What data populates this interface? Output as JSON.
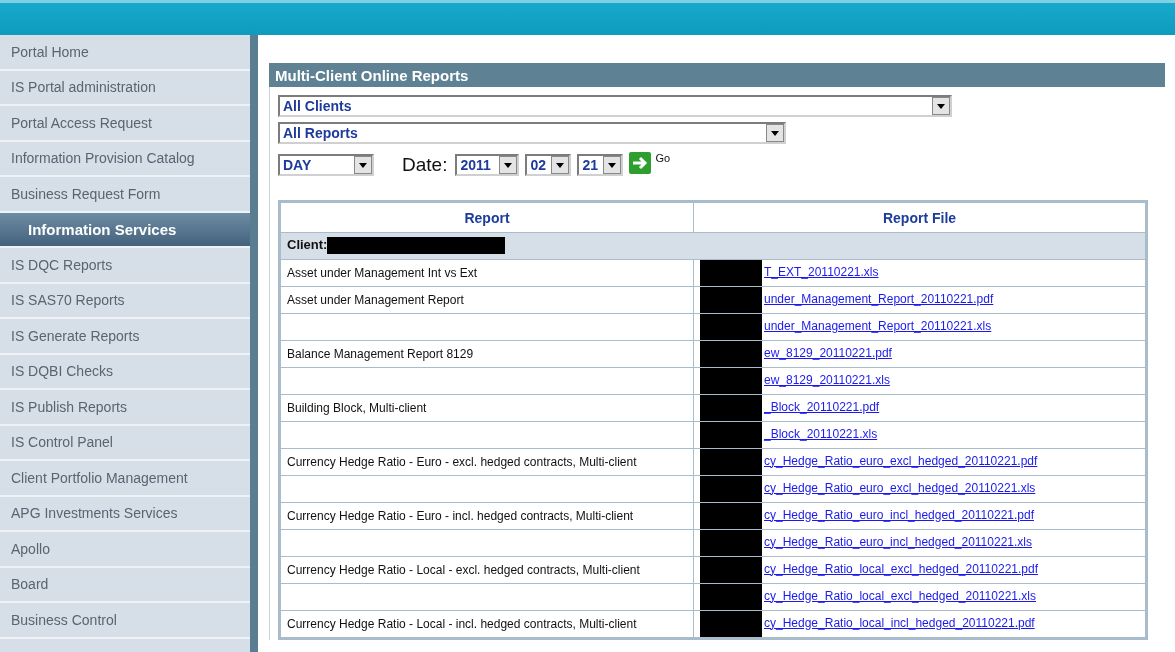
{
  "sidebar": {
    "items": [
      {
        "label": "Portal Home",
        "kind": "link"
      },
      {
        "label": "IS Portal administration",
        "kind": "link"
      },
      {
        "label": "Portal Access Request",
        "kind": "link"
      },
      {
        "label": "Information Provision Catalog",
        "kind": "link"
      },
      {
        "label": "Business Request Form",
        "kind": "link"
      },
      {
        "label": "Information Services",
        "kind": "section"
      },
      {
        "label": "IS DQC Reports",
        "kind": "link"
      },
      {
        "label": "IS SAS70 Reports",
        "kind": "link"
      },
      {
        "label": "IS Generate Reports",
        "kind": "link"
      },
      {
        "label": "IS DQBI Checks",
        "kind": "link"
      },
      {
        "label": "IS Publish Reports",
        "kind": "link"
      },
      {
        "label": "IS Control Panel",
        "kind": "link"
      },
      {
        "label": "Client Portfolio Management",
        "kind": "link"
      },
      {
        "label": "APG Investments Services",
        "kind": "link"
      },
      {
        "label": "Apollo",
        "kind": "link"
      },
      {
        "label": "Board",
        "kind": "link"
      },
      {
        "label": "Business Control",
        "kind": "link"
      }
    ]
  },
  "panel": {
    "title": "Multi-Client Online Reports",
    "client_select": "All Clients",
    "report_select": "All Reports",
    "period_select": "DAY",
    "date_label": "Date:",
    "year": "2011",
    "month": "02",
    "day": "21",
    "go": "Go"
  },
  "table": {
    "columns": [
      "Report",
      "Report File"
    ],
    "group_label": "Client:",
    "rows": [
      {
        "report": "Asset under Management Int vs Ext",
        "file": "T_EXT_20110221.xls"
      },
      {
        "report": "Asset under Management Report",
        "file": "under_Management_Report_20110221.pdf"
      },
      {
        "report": "",
        "file": "under_Management_Report_20110221.xls"
      },
      {
        "report": "Balance Management Report 8129",
        "file": "ew_8129_20110221.pdf"
      },
      {
        "report": "",
        "file": "ew_8129_20110221.xls"
      },
      {
        "report": "Building Block, Multi-client",
        "file": "_Block_20110221.pdf"
      },
      {
        "report": "",
        "file": "_Block_20110221.xls"
      },
      {
        "report": "Currency Hedge Ratio - Euro - excl. hedged contracts, Multi-client",
        "file": "cy_Hedge_Ratio_euro_excl_hedged_20110221.pdf"
      },
      {
        "report": "",
        "file": "cy_Hedge_Ratio_euro_excl_hedged_20110221.xls"
      },
      {
        "report": "Currency Hedge Ratio - Euro - incl. hedged contracts, Multi-client",
        "file": "cy_Hedge_Ratio_euro_incl_hedged_20110221.pdf"
      },
      {
        "report": "",
        "file": "cy_Hedge_Ratio_euro_incl_hedged_20110221.xls"
      },
      {
        "report": "Currency Hedge Ratio - Local - excl. hedged contracts, Multi-client",
        "file": "cy_Hedge_Ratio_local_excl_hedged_20110221.pdf"
      },
      {
        "report": "",
        "file": "cy_Hedge_Ratio_local_excl_hedged_20110221.xls"
      },
      {
        "report": "Currency Hedge Ratio - Local - incl. hedged contracts, Multi-client",
        "file": "cy_Hedge_Ratio_local_incl_hedged_20110221.pdf"
      }
    ]
  }
}
